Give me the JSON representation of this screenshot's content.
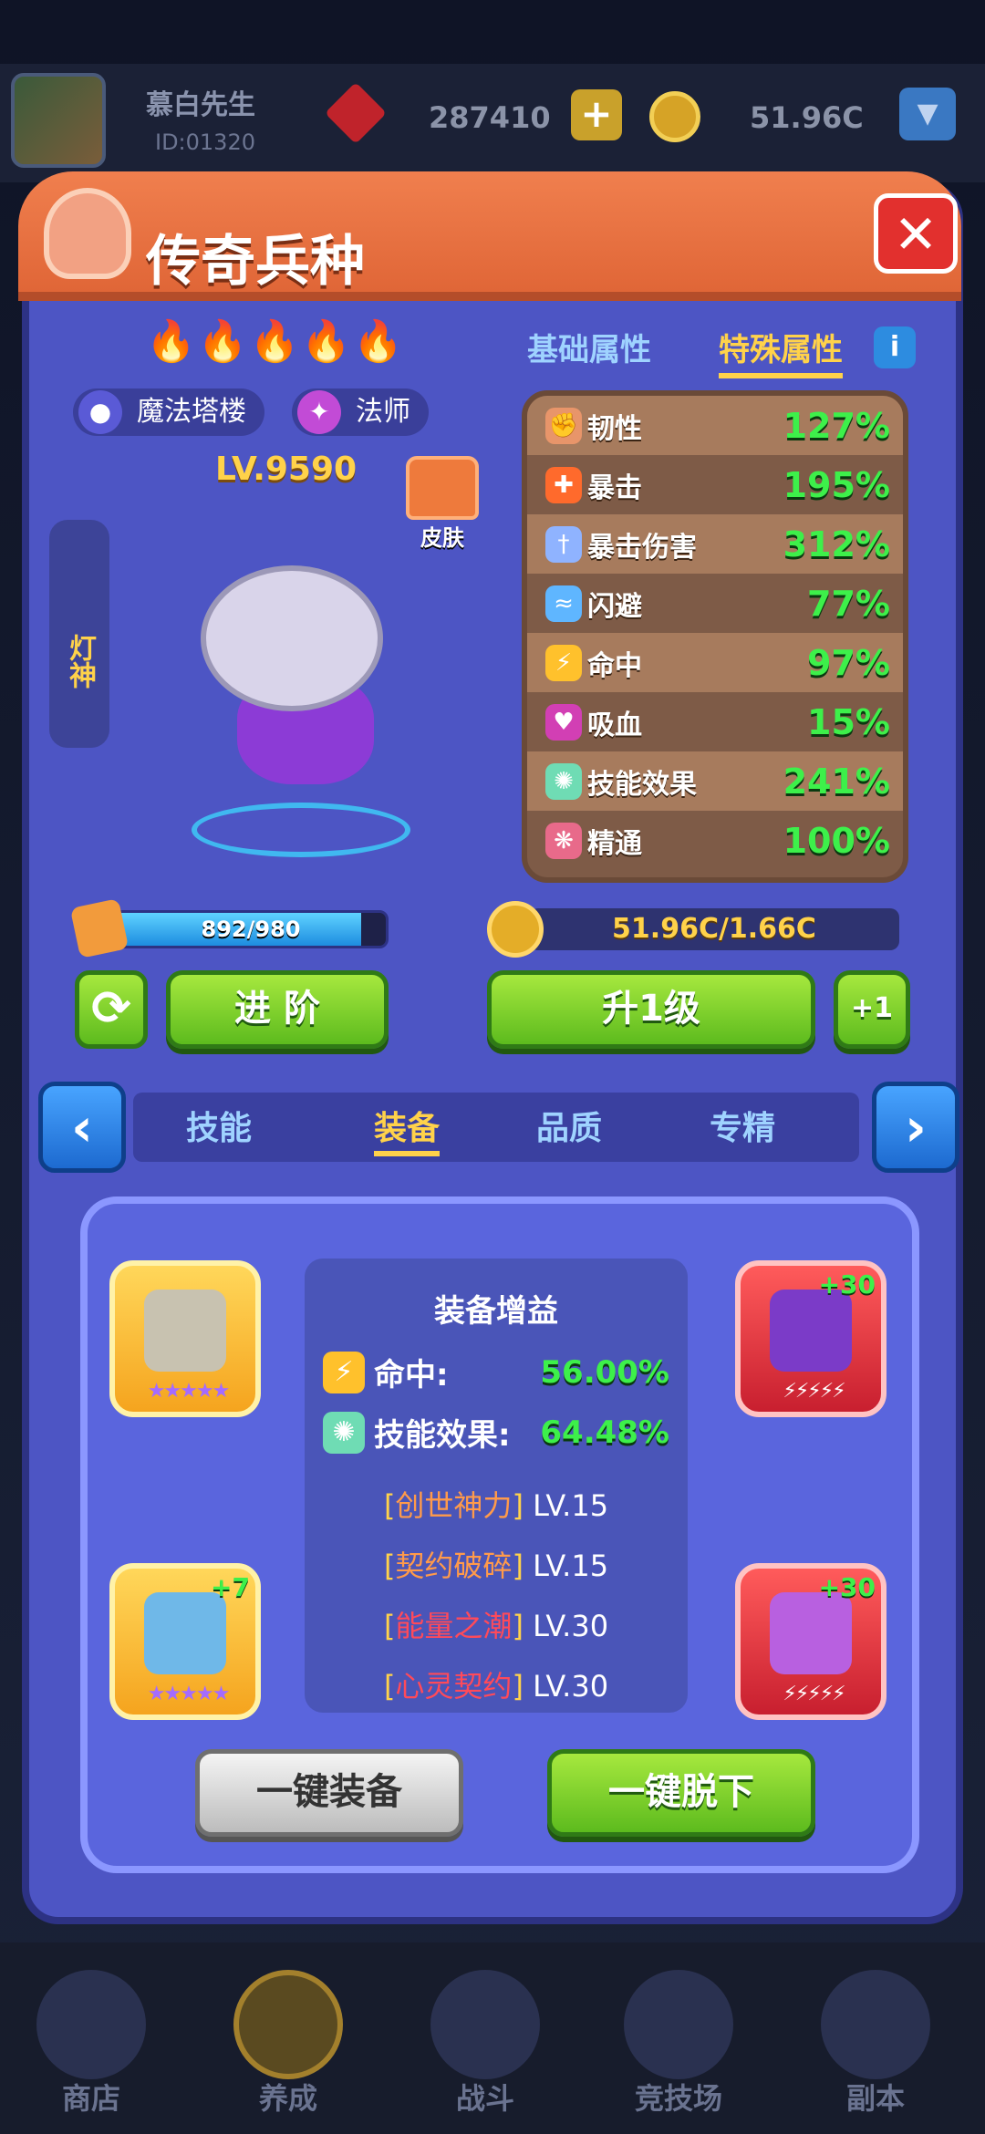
{
  "user": {
    "name": "慕白先生",
    "id": "ID:01320"
  },
  "resources": {
    "gems": "287410",
    "gold": "51.96C"
  },
  "header": {
    "title": "传奇兵种"
  },
  "hero": {
    "flames": "🔥🔥🔥🔥🔥",
    "tower": "魔法塔楼",
    "class": "法师",
    "level": "LV.9590",
    "skin_label": "皮肤",
    "name_vertical": "灯神"
  },
  "attr_tabs": {
    "basic": "基础属性",
    "special": "特殊属性",
    "info": "i"
  },
  "stats": [
    {
      "label": "韧性",
      "value": "127%"
    },
    {
      "label": "暴击",
      "value": "195%"
    },
    {
      "label": "暴击伤害",
      "value": "312%"
    },
    {
      "label": "闪避",
      "value": "77%"
    },
    {
      "label": "命中",
      "value": "97%"
    },
    {
      "label": "吸血",
      "value": "15%"
    },
    {
      "label": "技能效果",
      "value": "241%"
    },
    {
      "label": "精通",
      "value": "100%"
    }
  ],
  "progress": {
    "text": "892/980",
    "fraction": 0.91
  },
  "gold_cost": "51.96C/1.66C",
  "buttons": {
    "advance": "进 阶",
    "upgrade": "升1级",
    "plus_one": "+1",
    "equip_all": "一键装备",
    "unequip_all": "一键脱下"
  },
  "tabs": [
    {
      "label": "技能"
    },
    {
      "label": "装备"
    },
    {
      "label": "品质"
    },
    {
      "label": "专精"
    }
  ],
  "equipment": {
    "bonus_title": "装备增益",
    "hit_label": "命中:",
    "hit_value": "56.00%",
    "skill_label": "技能效果:",
    "skill_value": "64.48%",
    "skills": [
      {
        "name": "创世神力",
        "level": "LV.15"
      },
      {
        "name": "契约破碎",
        "level": "LV.15"
      },
      {
        "name": "能量之潮",
        "level": "LV.30"
      },
      {
        "name": "心灵契约",
        "level": "LV.30"
      }
    ],
    "slot_plus_tr": "+30",
    "slot_plus_bl": "+7",
    "slot_plus_br": "+30"
  },
  "bottom_nav": [
    {
      "label": "商店"
    },
    {
      "label": "养成"
    },
    {
      "label": "战斗"
    },
    {
      "label": "竞技场"
    },
    {
      "label": "副本"
    }
  ],
  "colors": {
    "accent_green": "#3df04a",
    "title_orange": "#e06637",
    "gold": "#ffd24a"
  }
}
